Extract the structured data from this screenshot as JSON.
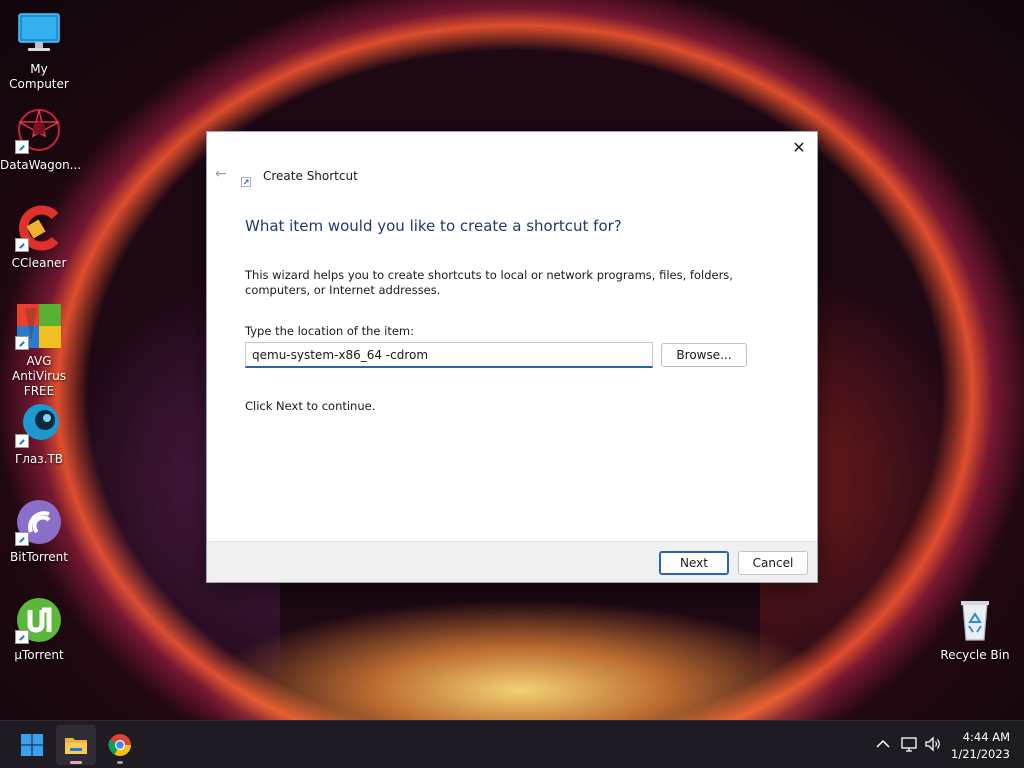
{
  "desktop": {
    "icons": [
      {
        "label": "My Computer",
        "icon": "monitor-icon",
        "shortcut": false
      },
      {
        "label": "DataWagon...",
        "icon": "datawagon-icon",
        "shortcut": true
      },
      {
        "label": "CCleaner",
        "icon": "ccleaner-icon",
        "shortcut": true
      },
      {
        "label": "AVG AntiVirus\nFREE",
        "icon": "avg-icon",
        "shortcut": true
      },
      {
        "label": "Глаз.ТВ",
        "icon": "glaz-tv-icon",
        "shortcut": true
      },
      {
        "label": "BitTorrent",
        "icon": "bittorrent-icon",
        "shortcut": true
      },
      {
        "label": "µTorrent",
        "icon": "utorrent-icon",
        "shortcut": true
      }
    ],
    "recycle_bin": {
      "label": "Recycle Bin",
      "icon": "recycle-bin-icon"
    }
  },
  "dialog": {
    "caption": "Create Shortcut",
    "heading": "What item would you like to create a shortcut for?",
    "description": "This wizard helps you to create shortcuts to local or network programs, files, folders, computers, or Internet addresses.",
    "location_label": "Type the location of the item:",
    "location_value": "qemu-system-x86_64 -cdrom",
    "browse_label": "Browse...",
    "hint": "Click Next to continue.",
    "next_label": "Next",
    "cancel_label": "Cancel",
    "close_glyph": "✕",
    "back_glyph": "←"
  },
  "taskbar": {
    "items": [
      {
        "name": "start-button",
        "icon": "windows-logo-icon"
      },
      {
        "name": "file-explorer",
        "icon": "folder-icon",
        "active": true
      },
      {
        "name": "chrome",
        "icon": "chrome-icon"
      }
    ],
    "tray": {
      "chevron": "^",
      "time": "4:44 AM",
      "date": "1/21/2023"
    }
  },
  "colors": {
    "accent": "#2a62b8",
    "heading": "#1f3a6e",
    "taskbar": "#1e1c22"
  }
}
